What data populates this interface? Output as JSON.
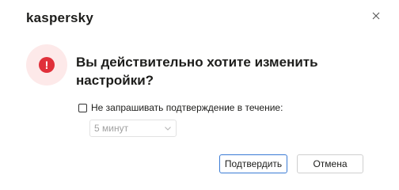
{
  "header": {
    "logo_text": "kaspersky",
    "close_icon": "close-icon"
  },
  "alert": {
    "icon": "exclamation-icon",
    "icon_glyph": "!",
    "circle_color": "#fde9e9",
    "icon_color": "#e0303a"
  },
  "message": {
    "title": "Вы действительно хотите изменить настройки?"
  },
  "options": {
    "dont_ask_label": "Не запрашивать подтверждение в течение:",
    "dont_ask_checked": false,
    "duration_selected": "5 минут"
  },
  "buttons": {
    "confirm_label": "Подтвердить",
    "cancel_label": "Отмена"
  }
}
